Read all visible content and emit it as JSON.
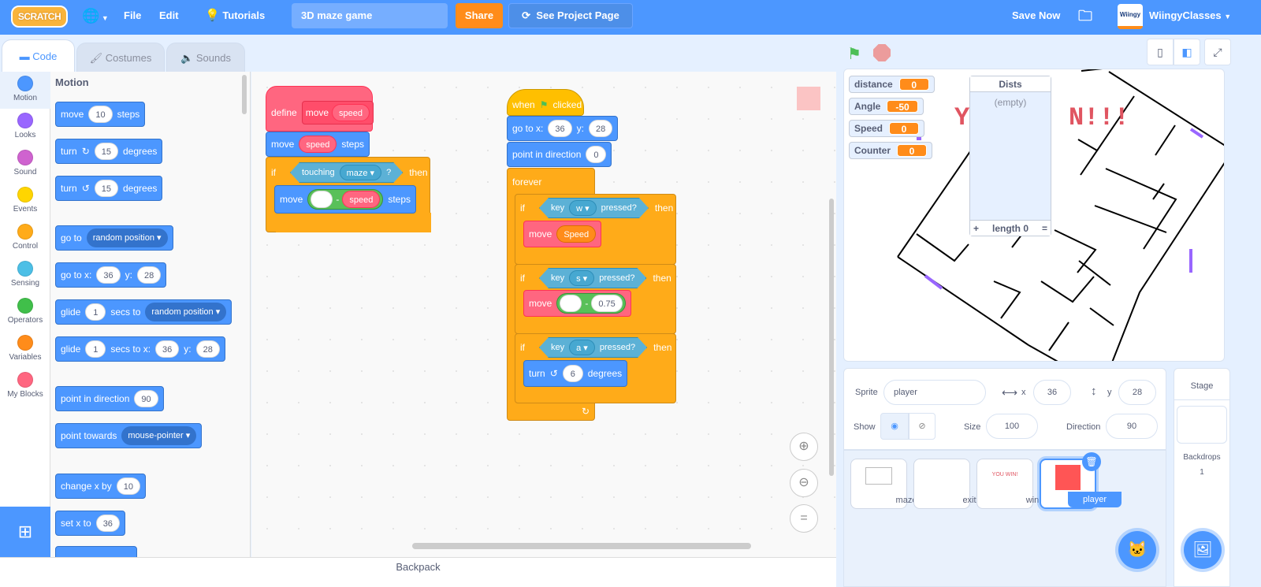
{
  "menubar": {
    "logo": "SCRATCH",
    "language_icon": "globe-icon",
    "file": "File",
    "edit": "Edit",
    "tutorials": "Tutorials",
    "project_title": "3D maze game",
    "share": "Share",
    "see_project_page": "See Project Page",
    "save_now": "Save Now",
    "username": "WiingyClasses",
    "avatar_text": "Wiingy"
  },
  "tabs": [
    {
      "label": "Code",
      "icon": "code-icon"
    },
    {
      "label": "Costumes",
      "icon": "brush-icon"
    },
    {
      "label": "Sounds",
      "icon": "speaker-icon"
    }
  ],
  "categories": [
    {
      "label": "Motion",
      "color": "#4c97ff"
    },
    {
      "label": "Looks",
      "color": "#9966ff"
    },
    {
      "label": "Sound",
      "color": "#cf63cf"
    },
    {
      "label": "Events",
      "color": "#ffd500"
    },
    {
      "label": "Control",
      "color": "#ffab19"
    },
    {
      "label": "Sensing",
      "color": "#4cbfe6"
    },
    {
      "label": "Operators",
      "color": "#40bf4a"
    },
    {
      "label": "Variables",
      "color": "#ff8c1a"
    },
    {
      "label": "My Blocks",
      "color": "#ff6680"
    }
  ],
  "palette": {
    "section": "Motion",
    "blocks": {
      "move": {
        "a": "move",
        "v": "10",
        "b": "steps"
      },
      "turn_right": {
        "a": "turn",
        "v": "15",
        "b": "degrees"
      },
      "turn_left": {
        "a": "turn",
        "v": "15",
        "b": "degrees"
      },
      "goto": {
        "a": "go to",
        "dd": "random position"
      },
      "gotoxy": {
        "a": "go to x:",
        "x": "36",
        "yl": "y:",
        "y": "28"
      },
      "glide": {
        "a": "glide",
        "v": "1",
        "b": "secs to",
        "dd": "random position"
      },
      "glidexy": {
        "a": "glide",
        "v": "1",
        "b": "secs to x:",
        "x": "36",
        "yl": "y:",
        "y": "28"
      },
      "point": {
        "a": "point in direction",
        "v": "90"
      },
      "towards": {
        "a": "point towards",
        "dd": "mouse-pointer"
      },
      "changex": {
        "a": "change x by",
        "v": "10"
      },
      "setx": {
        "a": "set x to",
        "v": "36"
      }
    }
  },
  "script1": {
    "define": "define",
    "proc_name": "move",
    "proc_arg": "speed",
    "move_label": "move",
    "move_arg": "speed",
    "steps": "steps",
    "if": "if",
    "touching": "touching",
    "touching_target": "maze",
    "q": "?",
    "then": "then",
    "inner_move": "move",
    "minus": "-",
    "inner_arg": "speed",
    "inner_steps": "steps"
  },
  "script2": {
    "when": "when",
    "clicked": "clicked",
    "goto": "go to x:",
    "x": "36",
    "ylabel": "y:",
    "y": "28",
    "point": "point in direction",
    "dir": "0",
    "forever": "forever",
    "if1": {
      "if": "if",
      "key": "key",
      "k": "w",
      "pressed": "pressed?",
      "then": "then",
      "move": "move",
      "arg": "Speed"
    },
    "if2": {
      "if": "if",
      "key": "key",
      "k": "s",
      "pressed": "pressed?",
      "then": "then",
      "move": "move",
      "minus": "-",
      "arg": "0.75"
    },
    "if3": {
      "if": "if",
      "key": "key",
      "k": "a",
      "pressed": "pressed?",
      "then": "then",
      "turn": "turn",
      "arg": "6",
      "degrees": "degrees"
    }
  },
  "workspace_controls": {
    "zoom_in": "+",
    "zoom_out": "−",
    "reset": "="
  },
  "backpack": "Backpack",
  "stage": {
    "monitors": [
      {
        "label": "distance",
        "value": "0"
      },
      {
        "label": "Angle",
        "value": "-50"
      },
      {
        "label": "Speed",
        "value": "0"
      },
      {
        "label": "Counter",
        "value": "0"
      }
    ],
    "list_monitor": {
      "title": "Dists",
      "empty": "(empty)",
      "add": "+",
      "length": "length 0",
      "resize": "="
    },
    "banner_text": "YOU WON!!!"
  },
  "sprite_info": {
    "sprite_label": "Sprite",
    "sprite_name": "player",
    "x_label": "x",
    "x": "36",
    "y_label": "y",
    "y": "28",
    "show_label": "Show",
    "size_label": "Size",
    "size": "100",
    "direction_label": "Direction",
    "direction": "90"
  },
  "sprites": [
    {
      "name": "maze",
      "selected": false
    },
    {
      "name": "exit",
      "selected": false
    },
    {
      "name": "win",
      "selected": false,
      "thumb_text": "YOU WIN!"
    },
    {
      "name": "player",
      "selected": true,
      "color": "#ff5555"
    }
  ],
  "stage_pane": {
    "title": "Stage",
    "backdrops_label": "Backdrops",
    "backdrops_count": "1"
  }
}
